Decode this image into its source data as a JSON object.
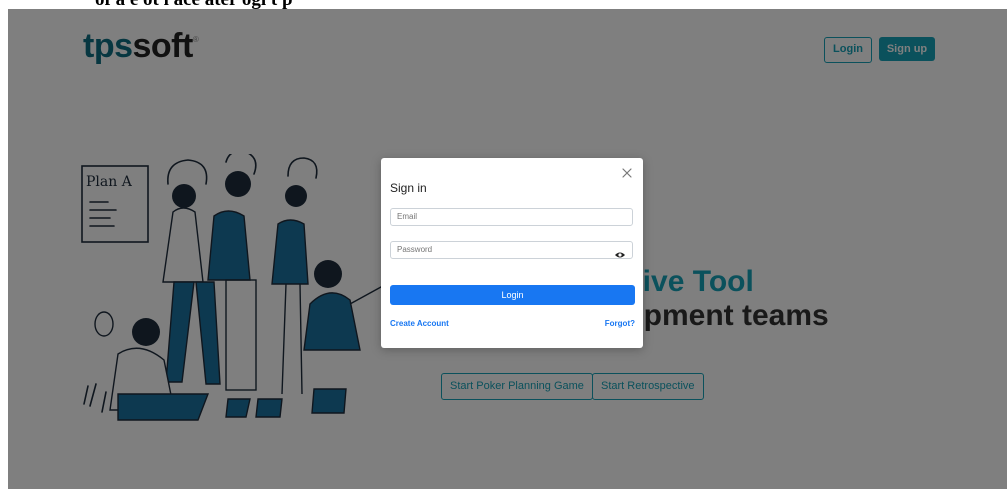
{
  "top_strip": {
    "text": "of a e ot i ace ater ogi t p"
  },
  "header": {
    "logo_part1": "tps",
    "logo_part2": "soft",
    "logo_mark": "®",
    "login_label": "Login",
    "signup_label": "Sign up"
  },
  "hero": {
    "line1": "ctive Tool",
    "line2": "lopment teams",
    "cta_poker": "Start Poker Planning Game",
    "cta_retro": "Start Retrospective"
  },
  "illustration": {
    "whiteboard_text": "Plan A"
  },
  "modal": {
    "title": "Sign in",
    "email_placeholder": "Email",
    "password_placeholder": "Password",
    "login_button": "Login",
    "create_account": "Create Account",
    "forgot": "Forgot?"
  },
  "colors": {
    "brand": "#17a2b8",
    "logo_teal": "#0e6f83",
    "primary": "#1877f2"
  }
}
